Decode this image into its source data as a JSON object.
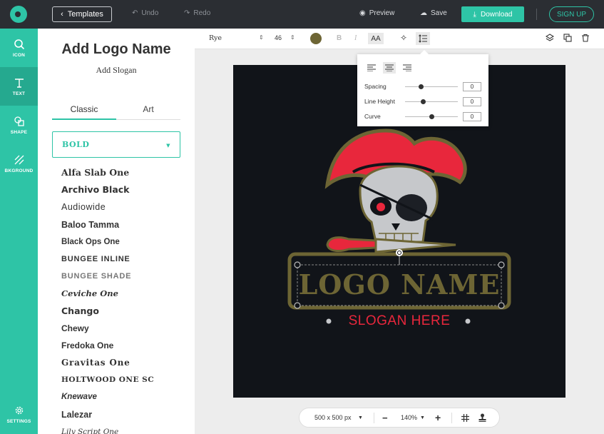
{
  "topbar": {
    "templates_label": "Templates",
    "undo_label": "Undo",
    "redo_label": "Redo",
    "preview_label": "Preview",
    "save_label": "Save",
    "download_label": "Download",
    "signup_label": "SIGN UP"
  },
  "rail": {
    "items": [
      {
        "label": "ICON",
        "icon": "search-icon"
      },
      {
        "label": "TEXT",
        "icon": "text-icon"
      },
      {
        "label": "SHAPE",
        "icon": "shape-icon"
      },
      {
        "label": "BKGROUND",
        "icon": "background-icon"
      }
    ],
    "settings_label": "SETTINGS"
  },
  "panel": {
    "title": "Add Logo Name",
    "slogan": "Add Slogan",
    "tabs": [
      "Classic",
      "Art"
    ],
    "selected_category": "Bold",
    "fonts": [
      "Alfa Slab One",
      "Archivo Black",
      "Audiowide",
      "Baloo Tamma",
      "Black Ops One",
      "BUNGEE INLINE",
      "BUNGEE SHADE",
      "Ceviche One",
      "Chango",
      "Chewy",
      "Fredoka One",
      "Gravitas One",
      "HOLTWOOD ONE SC",
      "Knewave",
      "Lalezar",
      "Lily Script One"
    ]
  },
  "subbar": {
    "font_name": "Rye",
    "font_size": "46",
    "bold": "B",
    "italic": "I",
    "case": "AA",
    "text_color": "#6d6534"
  },
  "popover": {
    "spacing_label": "Spacing",
    "spacing_value": "0",
    "line_height_label": "Line Height",
    "line_height_value": "0",
    "curve_label": "Curve",
    "curve_value": "0"
  },
  "canvas": {
    "logo_name": "LOGO NAME",
    "slogan": "SLOGAN HERE",
    "background": "#111419",
    "accent_red": "#e8273c",
    "accent_olive": "#6d6534"
  },
  "bottombar": {
    "size_label": "500 x 500 px",
    "zoom_label": "140%"
  },
  "colors": {
    "brand": "#2ec4a6",
    "topbar": "#2b2e33"
  }
}
